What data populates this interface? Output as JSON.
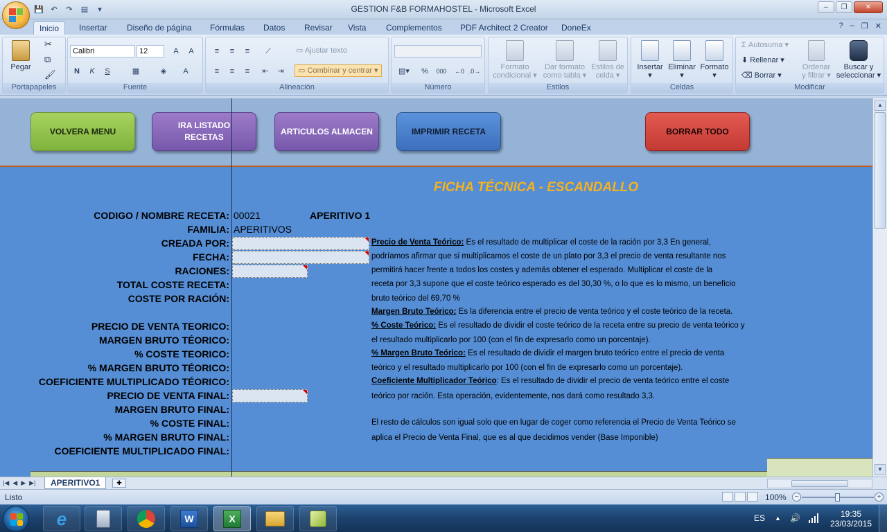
{
  "window": {
    "title": "GESTION F&B FORMAHOSTEL - Microsoft Excel",
    "controls": [
      "–",
      "❐",
      "✕"
    ]
  },
  "ribbon": {
    "tabs": [
      "Inicio",
      "Insertar",
      "Diseño de página",
      "Fórmulas",
      "Datos",
      "Revisar",
      "Vista",
      "Complementos",
      "PDF Architect 2 Creator",
      "DoneEx"
    ],
    "active_tab": "Inicio",
    "portapapeles": {
      "label": "Portapapeles",
      "pegar": "Pegar"
    },
    "fuente": {
      "label": "Fuente",
      "font_name": "Calibri",
      "font_size": "12"
    },
    "alineacion": {
      "label": "Alineación",
      "ajustar": "Ajustar texto",
      "combinar": "Combinar y centrar"
    },
    "numero": {
      "label": "Número",
      "percent": "%",
      "thousands": "000"
    },
    "estilos": {
      "label": "Estilos",
      "formato_condicional": [
        "Formato",
        "condicional"
      ],
      "dar_formato": [
        "Dar formato",
        "como tabla"
      ],
      "estilos_celda": [
        "Estilos de",
        "celda"
      ]
    },
    "celdas": {
      "label": "Celdas",
      "insertar": "Insertar",
      "eliminar": "Eliminar",
      "formato": "Formato"
    },
    "modificar": {
      "label": "Modificar",
      "autosuma": "Autosuma",
      "rellenar": "Rellenar",
      "borrar": "Borrar",
      "ordenar": [
        "Ordenar",
        "y filtrar"
      ],
      "buscar": [
        "Buscar y",
        "seleccionar"
      ]
    }
  },
  "sheet": {
    "buttons": {
      "volver": "VOLVERA MENU",
      "listado_line1": "IRA LISTADO",
      "listado_line2": "RECETAS",
      "articulos": "ARTICULOS ALMACEN",
      "imprimir": "IMPRIMIR RECETA",
      "borrar": "BORRAR TODO"
    },
    "title": "FICHA TÉCNICA - ESCANDALLO",
    "labels": {
      "codigo": "CODIGO / NOMBRE RECETA:",
      "familia": "FAMILIA:",
      "creada": "CREADA POR:",
      "fecha": "FECHA:",
      "raciones": "RACIONES:",
      "total_coste": "TOTAL COSTE RECETA:",
      "coste_racion": "COSTE POR RACIÓN:",
      "pv_teorico": "PRECIO DE VENTA TEORICO:",
      "mb_teorico": "MARGEN BRUTO TÉORICO:",
      "coste_teorico": "% COSTE TEORICO:",
      "pmb_teorico": "% MARGEN BRUTO TÉORICO:",
      "coef_teorico": "COEFICIENTE MULTIPLICADO TÉORICO:",
      "pv_final": "PRECIO DE VENTA FINAL:",
      "mb_final": "MARGEN BRUTO FINAL:",
      "coste_final": "% COSTE FINAL:",
      "pmb_final": "% MARGEN BRUTO FINAL:",
      "coef_final": "COEFICIENTE MULTIPLICADO FINAL:"
    },
    "values": {
      "codigo": "00021",
      "nombre": "APERITIVO 1",
      "familia": "APERITIVOS"
    },
    "desc": {
      "pv_teorico_title": "Precio de Venta Teórico:",
      "pv_teorico_1": " Es el resultado de multiplicar el coste de la ración por 3,3 En general,",
      "pv_teorico_2": "podríamos afirmar que si multiplicamos el coste de un plato por 3,3 el precio de venta resultante nos",
      "pv_teorico_3": "permitirá hacer frente a todos los costes y además obtener el esperado. Multiplicar el coste de la",
      "pv_teorico_4": "receta por 3,3 supone que el coste teórico esperado es del 30,30 %, o lo que es lo mismo, un beneficio",
      "pv_teorico_5": "bruto teórico del 69,70 %",
      "mb_title": "Margen Bruto Teórico:",
      "mb_1": " Es la diferencia entre el precio de venta teórico y el coste teórico de la receta.",
      "coste_title": "% Coste Teórico:",
      "coste_1": " Es el resultado de dividir el coste teórico de la receta entre su precio de venta teórico y",
      "coste_2": "el resultado multiplicarlo por 100 (con el fin de expresarlo como un porcentaje).",
      "pmb_title": "% Margen Bruto Teórico:",
      "pmb_1": " Es el resultado de dividir el margen bruto teórico entre el precio de venta",
      "pmb_2": "teórico y el resultado multiplicarlo por 100 (con el fin de expresarlo como un porcentaje).",
      "coef_title": "Coeficiente Multiplicador Teórico",
      "coef_1": ": Es el resultado de dividir el precio de venta teórico entre el coste",
      "coef_2": "teórico por ración. Esta operación, evidentemente, nos dará como resultado 3,3.",
      "resto_1": "El resto de cálculos son igual solo que en lugar de coger como referencia el Precio de Venta Teórico se",
      "resto_2": "aplica el Precio de Venta Final, que es al que decidimos vender (Base Imponible)"
    },
    "sheet_tab": "APERITIVO1"
  },
  "status": {
    "text": "Listo",
    "zoom": "100%"
  },
  "taskbar": {
    "language": "ES",
    "time": "19:35",
    "date": "23/03/2015"
  }
}
